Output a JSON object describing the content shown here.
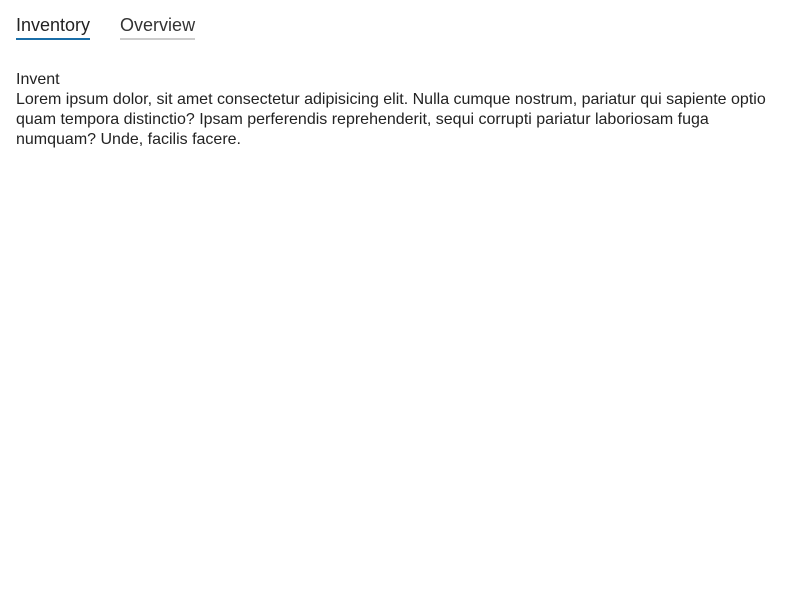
{
  "tabs": [
    {
      "label": "Inventory",
      "active": true
    },
    {
      "label": "Overview",
      "active": false
    }
  ],
  "panel": {
    "title": "Invent",
    "text": "Lorem ipsum dolor, sit amet consectetur adipisicing elit. Nulla cumque nostrum, pariatur qui sapiente optio quam tempora distinctio? Ipsam perferendis reprehenderit, sequi corrupti pariatur laboriosam fuga numquam? Unde, facilis facere."
  },
  "colors": {
    "active_tab_underline": "#1a6ea8",
    "inactive_tab_underline": "#cccccc",
    "text": "#222222"
  }
}
